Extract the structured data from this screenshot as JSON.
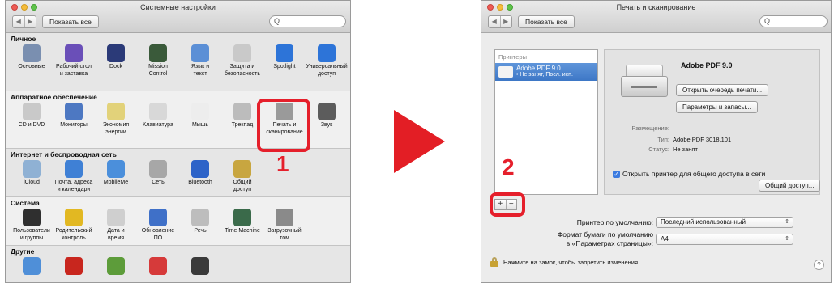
{
  "left_window": {
    "title": "Системные настройки",
    "show_all": "Показать все",
    "search_placeholder": "Q",
    "sections": [
      {
        "title": "Личное",
        "items": [
          {
            "label": "Основные",
            "icon": "general-icon",
            "color": "#7a8fb0"
          },
          {
            "label": "Рабочий стол\nи заставка",
            "icon": "desktop-icon",
            "color": "#6a4fb8"
          },
          {
            "label": "Dock",
            "icon": "dock-icon",
            "color": "#2b3a78"
          },
          {
            "label": "Mission\nControl",
            "icon": "mission-control-icon",
            "color": "#3a5a3a"
          },
          {
            "label": "Язык и\nтекст",
            "icon": "language-icon",
            "color": "#5b8fd6"
          },
          {
            "label": "Защита и\nбезопасность",
            "icon": "security-icon",
            "color": "#c9c9c9"
          },
          {
            "label": "Spotlight",
            "icon": "spotlight-icon",
            "color": "#2d74d8"
          },
          {
            "label": "Универсальный\nдоступ",
            "icon": "accessibility-icon",
            "color": "#2d74d8"
          }
        ]
      },
      {
        "title": "Аппаратное обеспечение",
        "items": [
          {
            "label": "CD и DVD",
            "icon": "cd-dvd-icon",
            "color": "#c9c9c9"
          },
          {
            "label": "Мониторы",
            "icon": "displays-icon",
            "color": "#4d78c2"
          },
          {
            "label": "Экономия\nэнергии",
            "icon": "energy-saver-icon",
            "color": "#e2d27a"
          },
          {
            "label": "Клавиатура",
            "icon": "keyboard-icon",
            "color": "#d8d8d8"
          },
          {
            "label": "Мышь",
            "icon": "mouse-icon",
            "color": "#ededed"
          },
          {
            "label": "Трекпад",
            "icon": "trackpad-icon",
            "color": "#bcbcbc"
          },
          {
            "label": "Печать и\nсканирование",
            "icon": "printer-icon",
            "color": "#9a9a9a"
          },
          {
            "label": "Звук",
            "icon": "sound-icon",
            "color": "#5c5c5c"
          }
        ]
      },
      {
        "title": "Интернет и беспроводная сеть",
        "items": [
          {
            "label": "iCloud",
            "icon": "icloud-icon",
            "color": "#8fb1d4"
          },
          {
            "label": "Почта, адреса\nи календари",
            "icon": "mail-contacts-icon",
            "color": "#3f80d5"
          },
          {
            "label": "MobileMe",
            "icon": "mobileme-icon",
            "color": "#4b8fdb"
          },
          {
            "label": "Сеть",
            "icon": "network-icon",
            "color": "#a7a7a7"
          },
          {
            "label": "Bluetooth",
            "icon": "bluetooth-icon",
            "color": "#2d63c8"
          },
          {
            "label": "Общий\nдоступ",
            "icon": "sharing-icon",
            "color": "#c8a640"
          }
        ]
      },
      {
        "title": "Система",
        "items": [
          {
            "label": "Пользователи\nи группы",
            "icon": "users-icon",
            "color": "#2f2f2f"
          },
          {
            "label": "Родительский\nконтроль",
            "icon": "parental-controls-icon",
            "color": "#e2b822"
          },
          {
            "label": "Дата и\nвремя",
            "icon": "date-time-icon",
            "color": "#cfcfcf"
          },
          {
            "label": "Обновление\nПО",
            "icon": "software-update-icon",
            "color": "#3f70c8"
          },
          {
            "label": "Речь",
            "icon": "speech-icon",
            "color": "#bdbdbd"
          },
          {
            "label": "Time Machine",
            "icon": "time-machine-icon",
            "color": "#3a6a4a"
          },
          {
            "label": "Загрузочный\nтом",
            "icon": "startup-disk-icon",
            "color": "#8a8a8a"
          }
        ]
      },
      {
        "title": "Другие",
        "items": [
          {
            "label": "",
            "icon": "globe-icon",
            "color": "#4f8fd8"
          },
          {
            "label": "",
            "icon": "flash-icon",
            "color": "#c8261e"
          },
          {
            "label": "",
            "icon": "wmv-icon",
            "color": "#5d9c3a"
          },
          {
            "label": "",
            "icon": "plugin-icon",
            "color": "#d63a3a"
          },
          {
            "label": "",
            "icon": "cube-icon",
            "color": "#3a3a3a"
          }
        ]
      }
    ]
  },
  "step1": "1",
  "step2": "2",
  "right_window": {
    "title": "Печать и сканирование",
    "show_all": "Показать все",
    "search_placeholder": "Q",
    "printers_header": "Принтеры",
    "printer": {
      "name": "Adobe PDF 9.0",
      "status": "Не занят, Посл. исп."
    },
    "plus": "+",
    "minus": "−",
    "detail": {
      "name": "Adobe PDF 9.0",
      "open_queue": "Открыть очередь печати...",
      "options": "Параметры и запасы...",
      "location_label": "Размещение:",
      "location_value": "",
      "type_label": "Тип:",
      "type_value": "Adobe PDF 3018.101",
      "status_label": "Статус:",
      "status_value": "Не занят",
      "share_check": "✓",
      "share_label": "Открыть принтер для общего доступа в сети",
      "sharing_button": "Общий доступ..."
    },
    "default_printer_label": "Принтер по умолчанию:",
    "default_printer_value": "Последний использованный",
    "paper_label_line1": "Формат бумаги по умолчанию",
    "paper_label_line2": "в «Параметрах страницы»:",
    "paper_value": "A4",
    "lock_text": "Нажмите на замок, чтобы запретить изменения.",
    "help": "?"
  },
  "colors": {
    "accent_red": "#e51f2b",
    "selection_blue": "#3d77c6"
  }
}
